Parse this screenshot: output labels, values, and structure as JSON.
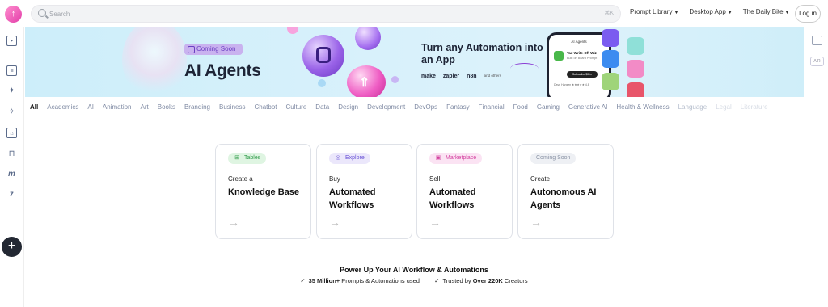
{
  "header": {
    "logo_glyph": "↑",
    "search_placeholder": "Search",
    "search_shortcut": "⌘K",
    "nav": [
      {
        "label": "Prompt Library"
      },
      {
        "label": "Desktop App"
      },
      {
        "label": "The Daily Bite"
      }
    ],
    "login_label": "Log in"
  },
  "right_sidebar": {
    "tag": "AIR"
  },
  "banner": {
    "coming_soon": "Coming Soon",
    "title": "AI Agents",
    "headline": "Turn any Automation into an App",
    "brands": [
      "make",
      "zapier",
      "n8n",
      "and others"
    ],
    "phone": {
      "header": "AI Agents",
      "app_name": "Tax Write-Off Wiz",
      "app_sub": "Built on Board Prompt",
      "subscribe": "Subscribe $9/m",
      "rating": "Dave Hansen ★★★★★ 4.8"
    }
  },
  "categories": [
    "All",
    "Academics",
    "AI",
    "Animation",
    "Art",
    "Books",
    "Branding",
    "Business",
    "Chatbot",
    "Culture",
    "Data",
    "Design",
    "Development",
    "DevOps",
    "Fantasy",
    "Financial",
    "Food",
    "Gaming",
    "Generative AI",
    "Health & Wellness",
    "Language",
    "Legal",
    "Literature"
  ],
  "cards": [
    {
      "badge": "Tables",
      "badge_icon": "⊞",
      "verb": "Create a",
      "object": "Knowledge Base",
      "arrow": "→"
    },
    {
      "badge": "Explore",
      "badge_icon": "◎",
      "verb": "Buy",
      "object": "Automated Workflows",
      "arrow": "→"
    },
    {
      "badge": "Marketplace",
      "badge_icon": "▣",
      "verb": "Sell",
      "object": "Automated Workflows",
      "arrow": "→"
    },
    {
      "badge": "Coming Soon",
      "badge_icon": "",
      "verb": "Create",
      "object": "Autonomous AI Agents",
      "arrow": "→"
    }
  ],
  "footer": {
    "title": "Power Up Your AI Workflow & Automations",
    "check": "✓",
    "stat1_bold": "35 Million+",
    "stat1_rest": " Prompts & Automations used",
    "stat2_pre": "Trusted by ",
    "stat2_bold": "Over 220K",
    "stat2_rest": " Creators"
  },
  "left_sidebar": {
    "plus": "+"
  },
  "colors": {
    "accent_pink": "#e33ea9",
    "tables_badge": "#dff5e2",
    "explore_badge": "#ebe7fb",
    "marketplace_badge": "#fbe3f3",
    "coming_soon_badge": "#eef0f4"
  }
}
